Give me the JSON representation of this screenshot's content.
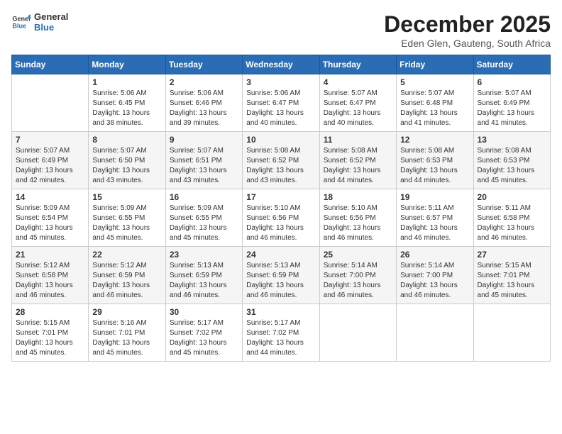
{
  "logo": {
    "line1": "General",
    "line2": "Blue"
  },
  "title": "December 2025",
  "subtitle": "Eden Glen, Gauteng, South Africa",
  "headers": [
    "Sunday",
    "Monday",
    "Tuesday",
    "Wednesday",
    "Thursday",
    "Friday",
    "Saturday"
  ],
  "weeks": [
    [
      {
        "day": "",
        "info": ""
      },
      {
        "day": "1",
        "info": "Sunrise: 5:06 AM\nSunset: 6:45 PM\nDaylight: 13 hours\nand 38 minutes."
      },
      {
        "day": "2",
        "info": "Sunrise: 5:06 AM\nSunset: 6:46 PM\nDaylight: 13 hours\nand 39 minutes."
      },
      {
        "day": "3",
        "info": "Sunrise: 5:06 AM\nSunset: 6:47 PM\nDaylight: 13 hours\nand 40 minutes."
      },
      {
        "day": "4",
        "info": "Sunrise: 5:07 AM\nSunset: 6:47 PM\nDaylight: 13 hours\nand 40 minutes."
      },
      {
        "day": "5",
        "info": "Sunrise: 5:07 AM\nSunset: 6:48 PM\nDaylight: 13 hours\nand 41 minutes."
      },
      {
        "day": "6",
        "info": "Sunrise: 5:07 AM\nSunset: 6:49 PM\nDaylight: 13 hours\nand 41 minutes."
      }
    ],
    [
      {
        "day": "7",
        "info": "Sunrise: 5:07 AM\nSunset: 6:49 PM\nDaylight: 13 hours\nand 42 minutes."
      },
      {
        "day": "8",
        "info": "Sunrise: 5:07 AM\nSunset: 6:50 PM\nDaylight: 13 hours\nand 43 minutes."
      },
      {
        "day": "9",
        "info": "Sunrise: 5:07 AM\nSunset: 6:51 PM\nDaylight: 13 hours\nand 43 minutes."
      },
      {
        "day": "10",
        "info": "Sunrise: 5:08 AM\nSunset: 6:52 PM\nDaylight: 13 hours\nand 43 minutes."
      },
      {
        "day": "11",
        "info": "Sunrise: 5:08 AM\nSunset: 6:52 PM\nDaylight: 13 hours\nand 44 minutes."
      },
      {
        "day": "12",
        "info": "Sunrise: 5:08 AM\nSunset: 6:53 PM\nDaylight: 13 hours\nand 44 minutes."
      },
      {
        "day": "13",
        "info": "Sunrise: 5:08 AM\nSunset: 6:53 PM\nDaylight: 13 hours\nand 45 minutes."
      }
    ],
    [
      {
        "day": "14",
        "info": "Sunrise: 5:09 AM\nSunset: 6:54 PM\nDaylight: 13 hours\nand 45 minutes."
      },
      {
        "day": "15",
        "info": "Sunrise: 5:09 AM\nSunset: 6:55 PM\nDaylight: 13 hours\nand 45 minutes."
      },
      {
        "day": "16",
        "info": "Sunrise: 5:09 AM\nSunset: 6:55 PM\nDaylight: 13 hours\nand 45 minutes."
      },
      {
        "day": "17",
        "info": "Sunrise: 5:10 AM\nSunset: 6:56 PM\nDaylight: 13 hours\nand 46 minutes."
      },
      {
        "day": "18",
        "info": "Sunrise: 5:10 AM\nSunset: 6:56 PM\nDaylight: 13 hours\nand 46 minutes."
      },
      {
        "day": "19",
        "info": "Sunrise: 5:11 AM\nSunset: 6:57 PM\nDaylight: 13 hours\nand 46 minutes."
      },
      {
        "day": "20",
        "info": "Sunrise: 5:11 AM\nSunset: 6:58 PM\nDaylight: 13 hours\nand 46 minutes."
      }
    ],
    [
      {
        "day": "21",
        "info": "Sunrise: 5:12 AM\nSunset: 6:58 PM\nDaylight: 13 hours\nand 46 minutes."
      },
      {
        "day": "22",
        "info": "Sunrise: 5:12 AM\nSunset: 6:59 PM\nDaylight: 13 hours\nand 46 minutes."
      },
      {
        "day": "23",
        "info": "Sunrise: 5:13 AM\nSunset: 6:59 PM\nDaylight: 13 hours\nand 46 minutes."
      },
      {
        "day": "24",
        "info": "Sunrise: 5:13 AM\nSunset: 6:59 PM\nDaylight: 13 hours\nand 46 minutes."
      },
      {
        "day": "25",
        "info": "Sunrise: 5:14 AM\nSunset: 7:00 PM\nDaylight: 13 hours\nand 46 minutes."
      },
      {
        "day": "26",
        "info": "Sunrise: 5:14 AM\nSunset: 7:00 PM\nDaylight: 13 hours\nand 46 minutes."
      },
      {
        "day": "27",
        "info": "Sunrise: 5:15 AM\nSunset: 7:01 PM\nDaylight: 13 hours\nand 45 minutes."
      }
    ],
    [
      {
        "day": "28",
        "info": "Sunrise: 5:15 AM\nSunset: 7:01 PM\nDaylight: 13 hours\nand 45 minutes."
      },
      {
        "day": "29",
        "info": "Sunrise: 5:16 AM\nSunset: 7:01 PM\nDaylight: 13 hours\nand 45 minutes."
      },
      {
        "day": "30",
        "info": "Sunrise: 5:17 AM\nSunset: 7:02 PM\nDaylight: 13 hours\nand 45 minutes."
      },
      {
        "day": "31",
        "info": "Sunrise: 5:17 AM\nSunset: 7:02 PM\nDaylight: 13 hours\nand 44 minutes."
      },
      {
        "day": "",
        "info": ""
      },
      {
        "day": "",
        "info": ""
      },
      {
        "day": "",
        "info": ""
      }
    ]
  ]
}
